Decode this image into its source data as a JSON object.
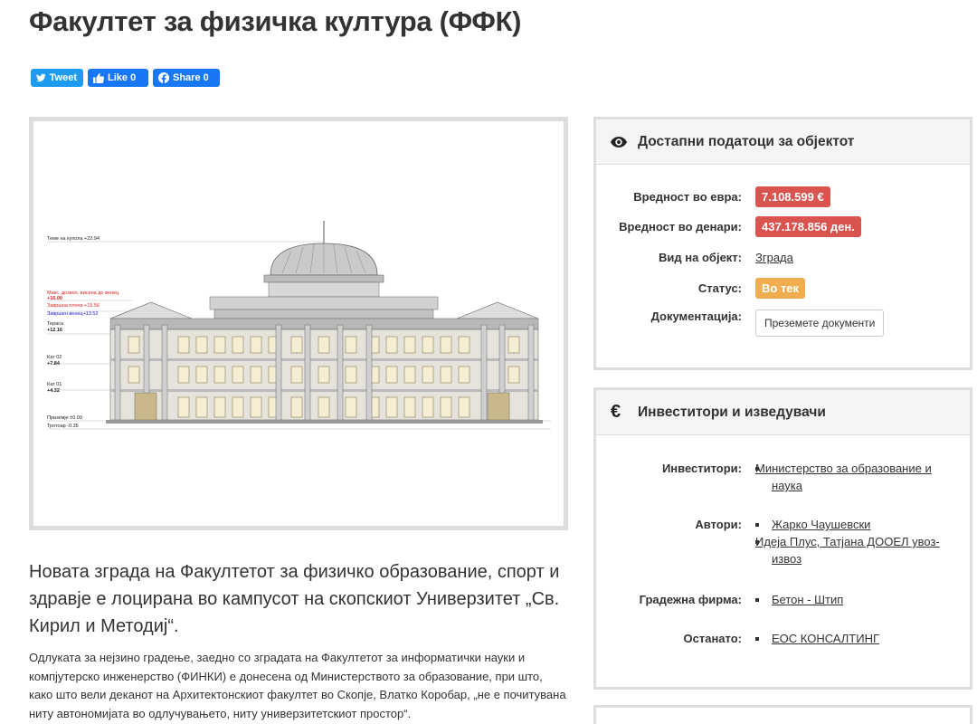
{
  "page": {
    "title": "Факултет за физичка култура (ФФК)"
  },
  "share": {
    "tweet": "Tweet",
    "like": "Like 0",
    "share": "Share 0"
  },
  "drawing_labels": {
    "dome_top": "Теме на купола +22.94",
    "max_height": "Макс. дозвол. висина до венец",
    "max_height_val": "+16.00",
    "roof_slab": "Завршна плоча +15.56",
    "cornice": "Завршен венец+13.52",
    "terrace": "Тераса",
    "terrace_val": "+12.16",
    "floor2": "Кат 02",
    "floor2_val": "+7.84",
    "floor1": "Кат 01",
    "floor1_val": "+4.32",
    "ground": "Приземје ±0.00",
    "sidewalk": "Тротоар -0.35"
  },
  "article": {
    "lead": "Новата зграда на Факултетот за физичко образование, спорт и здравје е лоцирана во кампусот на скопскиот Универзитет „Св. Кирил и Методиј“.",
    "body": "Одлуката за нејзино градење, заедно со зградата на Факултетот за информатички науки и компјутерско инженерство (ФИНКИ) е донесена од Министерството за образование, при што, како што вели деканот на Архитектонскиот факултет во Скопје, Влатко Коробар, „не е почитувана ниту автономијата во одлучувањето, ниту универзитетскиот простор“."
  },
  "info_card": {
    "title": "Достапни податоци за објектот",
    "icon": "eye-icon",
    "value_eur_label": "Вредност во евра:",
    "value_eur": "7.108.599 €",
    "value_mkd_label": "Вредност во денари:",
    "value_mkd": "437.178.856 ден.",
    "type_label": "Вид на објект:",
    "type": "Зграда",
    "status_label": "Статус:",
    "status": "Во тек",
    "docs_label": "Документација:",
    "docs_button": "Преземете документи",
    "colors": {
      "red_badge": "#d9534f",
      "orange_badge": "#f0ad4e"
    }
  },
  "investors_card": {
    "title": "Инвеститори и изведувачи",
    "icon": "euro-icon",
    "investors_label": "Инвеститори:",
    "investors": [
      "Министерство за образование и наука"
    ],
    "authors_label": "Автори:",
    "authors": [
      "Жарко Чаушевски",
      "Идеја Плус, Татјана ДООЕЛ увоз-извоз"
    ],
    "builder_label": "Градежна фирма:",
    "builders": [
      "Бетон - Штип"
    ],
    "other_label": "Останато:",
    "other": [
      "ЕОС КОНСАЛТИНГ"
    ]
  }
}
